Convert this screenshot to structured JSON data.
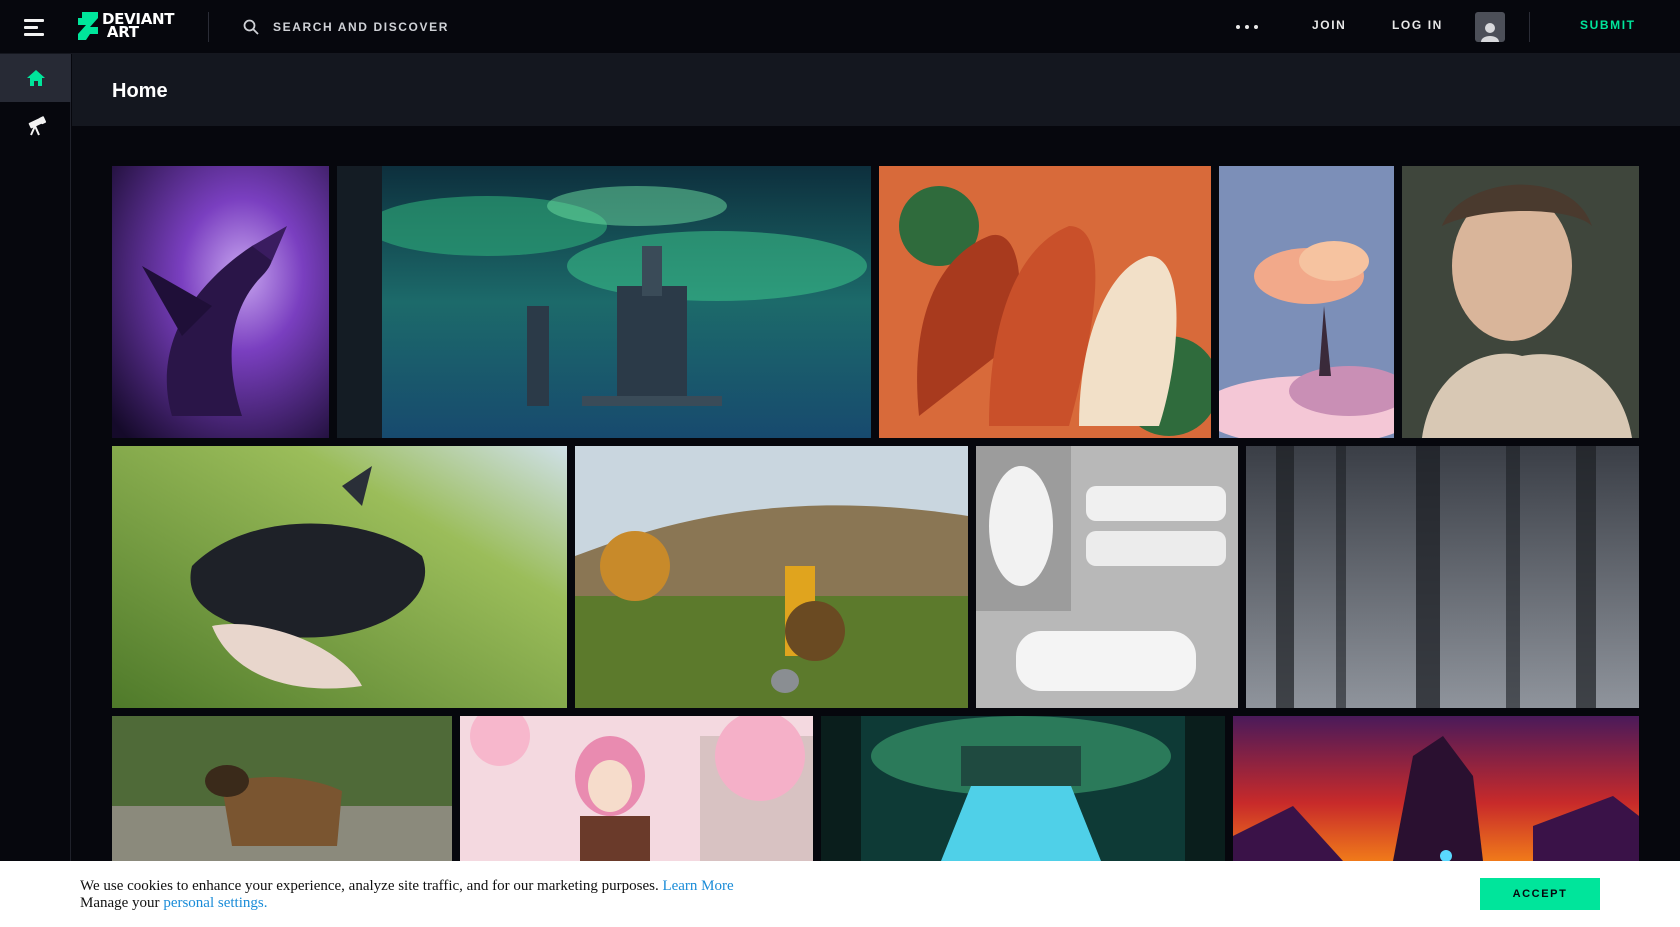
{
  "brand": {
    "logo_text": "DEVIANT ART",
    "accent": "#00e59b"
  },
  "header": {
    "search_placeholder": "SEARCH AND DISCOVER",
    "join_label": "JOIN",
    "login_label": "LOG IN",
    "submit_label": "SUBMIT"
  },
  "sidebar": {
    "items": [
      {
        "icon": "home-icon",
        "active": true
      },
      {
        "icon": "telescope-icon",
        "active": false
      }
    ]
  },
  "page": {
    "title": "Home"
  },
  "gallery": {
    "rows": [
      [
        "purple dragon",
        "green sky castle",
        "three horses",
        "pink tree pixel art",
        "portrait painting"
      ],
      [
        "black dragon on grass",
        "warrior with shield",
        "printed face masks",
        "misty forest"
      ],
      [
        "shepherd dog",
        "anime girl sakura",
        "waterfall temple",
        "red sky rocks"
      ]
    ]
  },
  "cookie_banner": {
    "line1": "We use cookies to enhance your experience, analyze site traffic, and for our marketing purposes.",
    "learn_more": "Learn More",
    "line2_prefix": "Manage your",
    "settings_link": "personal settings.",
    "accept_label": "ACCEPT"
  }
}
